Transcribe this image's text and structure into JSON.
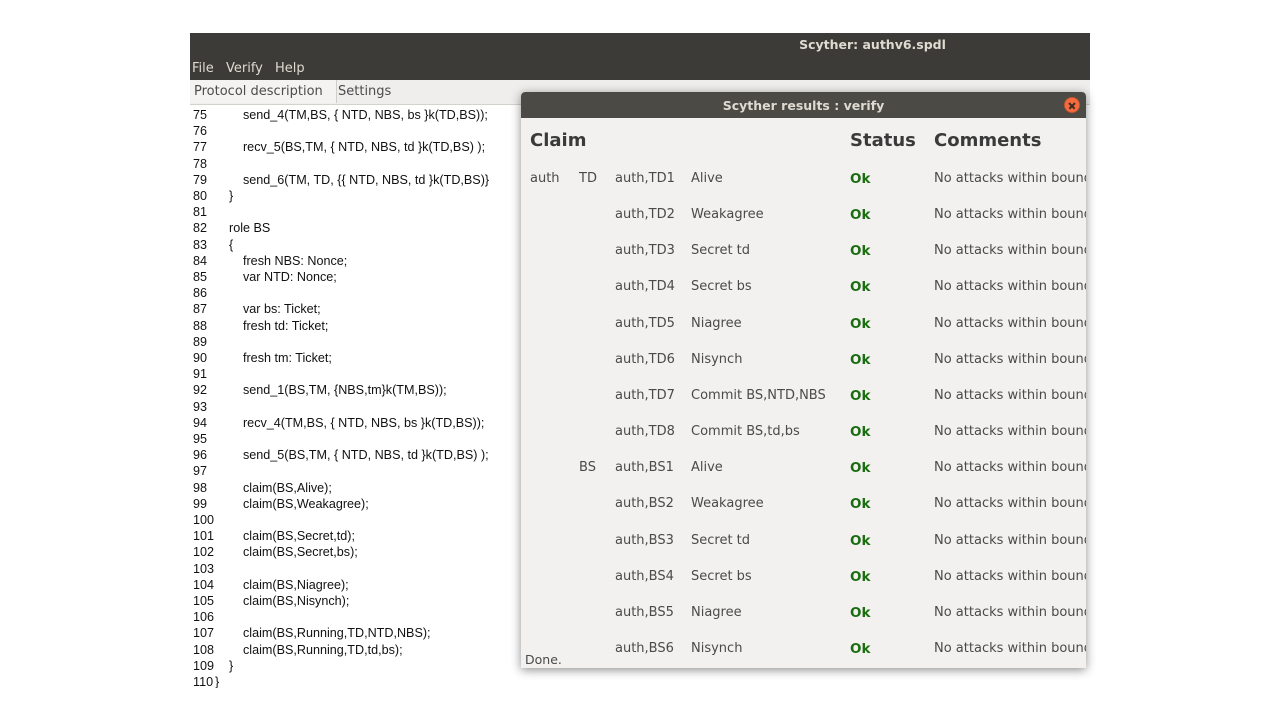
{
  "window": {
    "title": "Scyther: authv6.spdl"
  },
  "menu": [
    "File",
    "Verify",
    "Help"
  ],
  "tabs": {
    "protocol": "Protocol description",
    "settings": "Settings"
  },
  "code_lines": [
    {
      "n": "75",
      "t": "        send_4(TM,BS, { NTD, NBS, bs }k(TD,BS));"
    },
    {
      "n": "76",
      "t": ""
    },
    {
      "n": "77",
      "t": "        recv_5(BS,TM, { NTD, NBS, td }k(TD,BS) );"
    },
    {
      "n": "78",
      "t": ""
    },
    {
      "n": "79",
      "t": "        send_6(TM, TD, {{ NTD, NBS, td }k(TD,BS)}"
    },
    {
      "n": "80",
      "t": "    }"
    },
    {
      "n": "81",
      "t": ""
    },
    {
      "n": "82",
      "t": "    role BS"
    },
    {
      "n": "83",
      "t": "    {"
    },
    {
      "n": "84",
      "t": "        fresh NBS: Nonce;"
    },
    {
      "n": "85",
      "t": "        var NTD: Nonce;"
    },
    {
      "n": "86",
      "t": ""
    },
    {
      "n": "87",
      "t": "        var bs: Ticket;"
    },
    {
      "n": "88",
      "t": "        fresh td: Ticket;"
    },
    {
      "n": "89",
      "t": ""
    },
    {
      "n": "90",
      "t": "        fresh tm: Ticket;"
    },
    {
      "n": "91",
      "t": ""
    },
    {
      "n": "92",
      "t": "        send_1(BS,TM, {NBS,tm}k(TM,BS));"
    },
    {
      "n": "93",
      "t": ""
    },
    {
      "n": "94",
      "t": "        recv_4(TM,BS, { NTD, NBS, bs }k(TD,BS));"
    },
    {
      "n": "95",
      "t": ""
    },
    {
      "n": "96",
      "t": "        send_5(BS,TM, { NTD, NBS, td }k(TD,BS) );"
    },
    {
      "n": "97",
      "t": ""
    },
    {
      "n": "98",
      "t": "        claim(BS,Alive);"
    },
    {
      "n": "99",
      "t": "        claim(BS,Weakagree);"
    },
    {
      "n": "100",
      "t": ""
    },
    {
      "n": "101",
      "t": "        claim(BS,Secret,td);"
    },
    {
      "n": "102",
      "t": "        claim(BS,Secret,bs);"
    },
    {
      "n": "103",
      "t": ""
    },
    {
      "n": "104",
      "t": "        claim(BS,Niagree);"
    },
    {
      "n": "105",
      "t": "        claim(BS,Nisynch);"
    },
    {
      "n": "106",
      "t": ""
    },
    {
      "n": "107",
      "t": "        claim(BS,Running,TD,NTD,NBS);"
    },
    {
      "n": "108",
      "t": "        claim(BS,Running,TD,td,bs);"
    },
    {
      "n": "109",
      "t": "    }"
    },
    {
      "n": "110",
      "t": "}"
    }
  ],
  "results": {
    "title": "Scyther results : verify",
    "headers": {
      "claim": "Claim",
      "status": "Status",
      "comments": "Comments"
    },
    "rows": [
      {
        "protocol": "auth",
        "role": "TD",
        "id": "auth,TD1",
        "claim": "Alive",
        "status": "Ok",
        "comment": "No attacks within bounds."
      },
      {
        "protocol": "",
        "role": "",
        "id": "auth,TD2",
        "claim": "Weakagree",
        "status": "Ok",
        "comment": "No attacks within bounds."
      },
      {
        "protocol": "",
        "role": "",
        "id": "auth,TD3",
        "claim": "Secret td",
        "status": "Ok",
        "comment": "No attacks within bounds."
      },
      {
        "protocol": "",
        "role": "",
        "id": "auth,TD4",
        "claim": "Secret bs",
        "status": "Ok",
        "comment": "No attacks within bounds."
      },
      {
        "protocol": "",
        "role": "",
        "id": "auth,TD5",
        "claim": "Niagree",
        "status": "Ok",
        "comment": "No attacks within bounds."
      },
      {
        "protocol": "",
        "role": "",
        "id": "auth,TD6",
        "claim": "Nisynch",
        "status": "Ok",
        "comment": "No attacks within bounds."
      },
      {
        "protocol": "",
        "role": "",
        "id": "auth,TD7",
        "claim": "Commit BS,NTD,NBS",
        "status": "Ok",
        "comment": "No attacks within bounds."
      },
      {
        "protocol": "",
        "role": "",
        "id": "auth,TD8",
        "claim": "Commit BS,td,bs",
        "status": "Ok",
        "comment": "No attacks within bounds."
      },
      {
        "protocol": "",
        "role": "BS",
        "id": "auth,BS1",
        "claim": "Alive",
        "status": "Ok",
        "comment": "No attacks within bounds."
      },
      {
        "protocol": "",
        "role": "",
        "id": "auth,BS2",
        "claim": "Weakagree",
        "status": "Ok",
        "comment": "No attacks within bounds."
      },
      {
        "protocol": "",
        "role": "",
        "id": "auth,BS3",
        "claim": "Secret td",
        "status": "Ok",
        "comment": "No attacks within bounds."
      },
      {
        "protocol": "",
        "role": "",
        "id": "auth,BS4",
        "claim": "Secret bs",
        "status": "Ok",
        "comment": "No attacks within bounds."
      },
      {
        "protocol": "",
        "role": "",
        "id": "auth,BS5",
        "claim": "Niagree",
        "status": "Ok",
        "comment": "No attacks within bounds."
      },
      {
        "protocol": "",
        "role": "",
        "id": "auth,BS6",
        "claim": "Nisynch",
        "status": "Ok",
        "comment": "No attacks within bounds."
      }
    ],
    "status_text": "Done."
  },
  "colors": {
    "titlebar": "#3c3b37",
    "ok": "#1a6e10",
    "close": "#f36b3f"
  }
}
